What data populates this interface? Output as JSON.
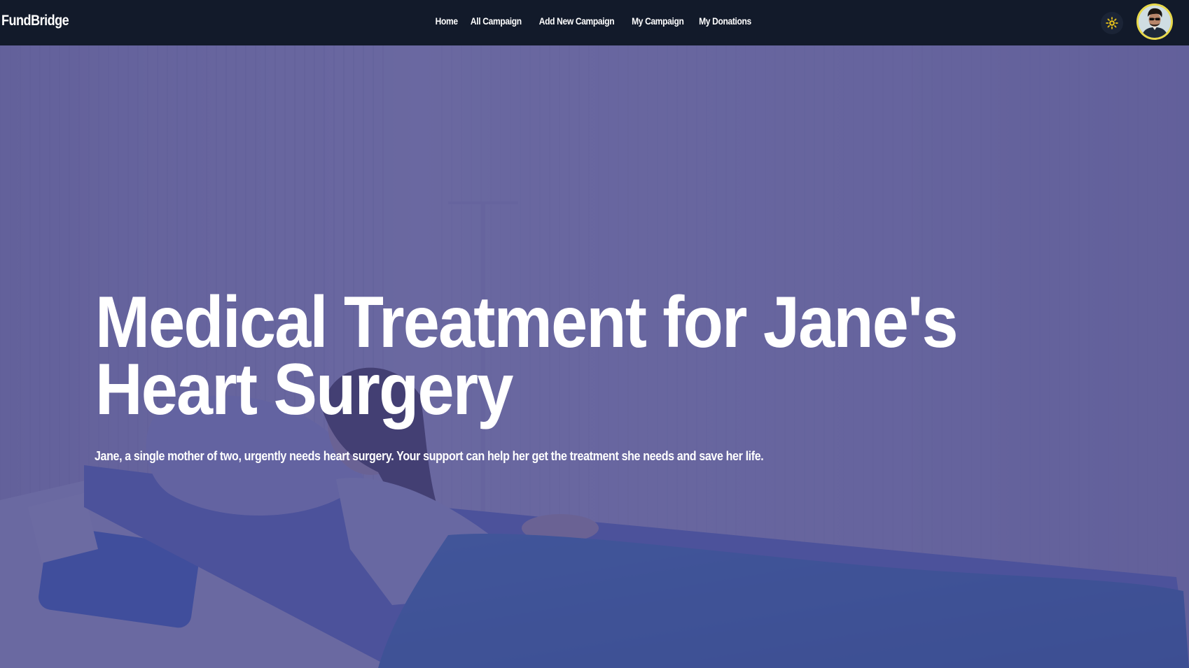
{
  "navbar": {
    "brand": "FundBridge",
    "links": [
      {
        "label": "Home"
      },
      {
        "label": "All Campaign"
      },
      {
        "label": "Add New Campaign"
      },
      {
        "label": "My Campaign"
      },
      {
        "label": "My Donations"
      }
    ],
    "theme_toggle_icon": "sun-icon",
    "avatar_icon": "user-avatar"
  },
  "hero": {
    "title": "Medical Treatment for Jane's Heart Surgery",
    "description": "Jane, a single mother of two, urgently needs heart surgery. Your support can help her get the treatment she needs and save her life.",
    "overlay_color": "#4b4a8c",
    "background_image": "patient-in-hospital-bed"
  },
  "colors": {
    "navbar_bg": "#121a2a",
    "accent_yellow": "#e8d94a",
    "text": "#ffffff"
  }
}
